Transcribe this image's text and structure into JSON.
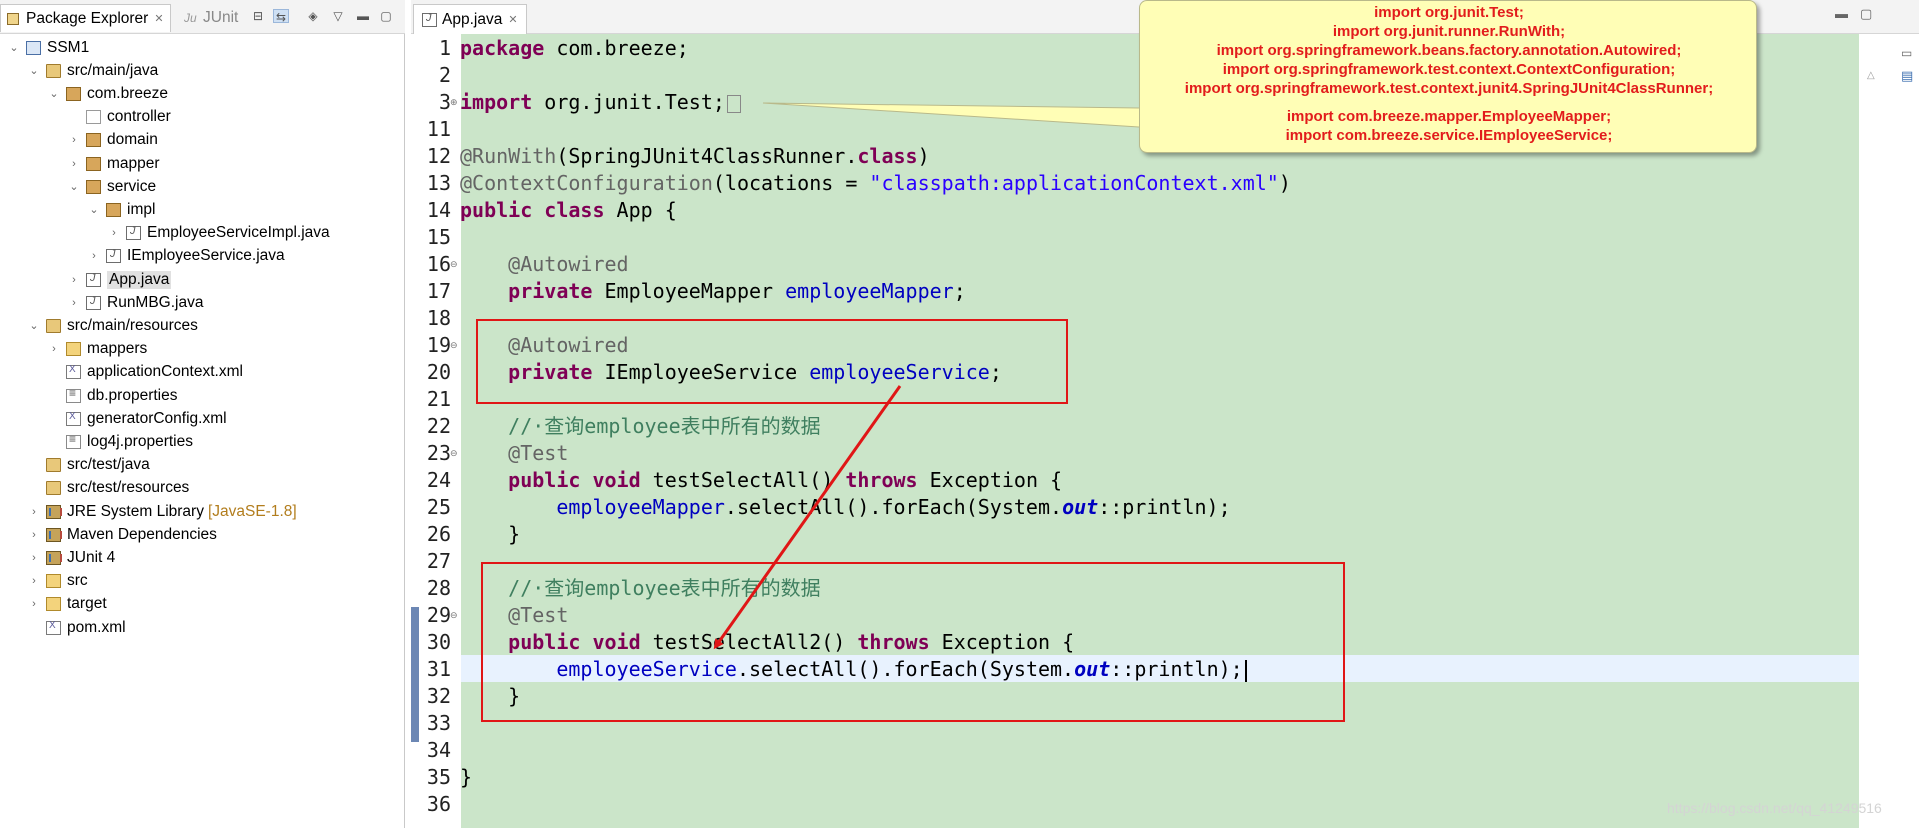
{
  "explorer": {
    "tab_label": "Package Explorer",
    "junit_tab_label": "JUnit",
    "tree": [
      {
        "label": "SSM1",
        "arrow": "v",
        "icon": "project"
      },
      {
        "label": "src/main/java",
        "arrow": "v",
        "icon": "srcfolder"
      },
      {
        "label": "com.breeze",
        "arrow": "v",
        "icon": "package"
      },
      {
        "label": "controller",
        "arrow": "",
        "icon": "package-empty"
      },
      {
        "label": "domain",
        "arrow": ">",
        "icon": "package"
      },
      {
        "label": "mapper",
        "arrow": ">",
        "icon": "package"
      },
      {
        "label": "service",
        "arrow": "v",
        "icon": "package"
      },
      {
        "label": "impl",
        "arrow": "v",
        "icon": "package"
      },
      {
        "label": "EmployeeServiceImpl.java",
        "arrow": ">",
        "icon": "java"
      },
      {
        "label": "IEmployeeService.java",
        "arrow": ">",
        "icon": "java"
      },
      {
        "label": "App.java",
        "arrow": ">",
        "icon": "java",
        "selected": true
      },
      {
        "label": "RunMBG.java",
        "arrow": ">",
        "icon": "java"
      },
      {
        "label": "src/main/resources",
        "arrow": "v",
        "icon": "srcfolder"
      },
      {
        "label": "mappers",
        "arrow": ">",
        "icon": "folder"
      },
      {
        "label": "applicationContext.xml",
        "arrow": "",
        "icon": "xml"
      },
      {
        "label": "db.properties",
        "arrow": "",
        "icon": "props"
      },
      {
        "label": "generatorConfig.xml",
        "arrow": "",
        "icon": "xml"
      },
      {
        "label": "log4j.properties",
        "arrow": "",
        "icon": "props"
      },
      {
        "label": "src/test/java",
        "arrow": "",
        "icon": "srcfolder"
      },
      {
        "label": "src/test/resources",
        "arrow": "",
        "icon": "srcfolder"
      },
      {
        "label": "JRE System Library",
        "decoration": "[JavaSE-1.8]",
        "arrow": ">",
        "icon": "lib"
      },
      {
        "label": "Maven Dependencies",
        "arrow": ">",
        "icon": "lib"
      },
      {
        "label": "JUnit 4",
        "arrow": ">",
        "icon": "lib"
      },
      {
        "label": "src",
        "arrow": ">",
        "icon": "folder"
      },
      {
        "label": "target",
        "arrow": ">",
        "icon": "folder"
      },
      {
        "label": "pom.xml",
        "arrow": "",
        "icon": "xml"
      }
    ]
  },
  "editor": {
    "tab_label": "App.java",
    "line_numbers": [
      "1",
      "2",
      "3",
      "11",
      "12",
      "13",
      "14",
      "15",
      "16",
      "17",
      "18",
      "19",
      "20",
      "21",
      "22",
      "23",
      "24",
      "25",
      "26",
      "27",
      "28",
      "29",
      "30",
      "31",
      "32",
      "33",
      "34",
      "35",
      "36"
    ],
    "lines": [
      [
        [
          "kw",
          "package"
        ],
        [
          "",
          " com.breeze;"
        ]
      ],
      [],
      [
        [
          "kw",
          "import"
        ],
        [
          "",
          " org.junit.Test;"
        ]
      ],
      [],
      [
        [
          "ann",
          "@RunWith"
        ],
        [
          "",
          "(SpringJUnit4ClassRunner."
        ],
        [
          "kw",
          "class"
        ],
        [
          "",
          ")"
        ]
      ],
      [
        [
          "ann",
          "@ContextConfiguration"
        ],
        [
          "",
          "(locations = "
        ],
        [
          "str",
          "\"classpath:applicationContext.xml\""
        ],
        [
          "",
          ")"
        ]
      ],
      [
        [
          "kw",
          "public"
        ],
        [
          "",
          " "
        ],
        [
          "kw",
          "class"
        ],
        [
          "",
          " App {"
        ]
      ],
      [],
      [
        [
          "",
          "    "
        ],
        [
          "ann",
          "@Autowired"
        ]
      ],
      [
        [
          "",
          "    "
        ],
        [
          "kw",
          "private"
        ],
        [
          "",
          " EmployeeMapper "
        ],
        [
          "fld",
          "employeeMapper"
        ],
        [
          "",
          ";"
        ]
      ],
      [],
      [
        [
          "",
          "    "
        ],
        [
          "ann",
          "@Autowired"
        ]
      ],
      [
        [
          "",
          "    "
        ],
        [
          "kw",
          "private"
        ],
        [
          "",
          " IEmployeeService "
        ],
        [
          "fld",
          "employeeService"
        ],
        [
          "",
          ";"
        ]
      ],
      [],
      [
        [
          "",
          "    "
        ],
        [
          "cmt",
          "//·查询employee表中所有的数据"
        ]
      ],
      [
        [
          "",
          "    "
        ],
        [
          "ann",
          "@Test"
        ]
      ],
      [
        [
          "",
          "    "
        ],
        [
          "kw",
          "public"
        ],
        [
          "",
          " "
        ],
        [
          "kw",
          "void"
        ],
        [
          "",
          " testSelectAll() "
        ],
        [
          "kw",
          "throws"
        ],
        [
          "",
          " Exception {"
        ]
      ],
      [
        [
          "",
          "        "
        ],
        [
          "fld",
          "employeeMapper"
        ],
        [
          "",
          ".selectAll().forEach(System."
        ],
        [
          "sfld",
          "out"
        ],
        [
          "",
          "::println);"
        ]
      ],
      [
        [
          "",
          "    }"
        ]
      ],
      [],
      [
        [
          "",
          "    "
        ],
        [
          "cmt",
          "//·查询employee表中所有的数据"
        ]
      ],
      [
        [
          "",
          "    "
        ],
        [
          "ann",
          "@Test"
        ]
      ],
      [
        [
          "",
          "    "
        ],
        [
          "kw",
          "public"
        ],
        [
          "",
          " "
        ],
        [
          "kw",
          "void"
        ],
        [
          "",
          " testSelectAll2() "
        ],
        [
          "kw",
          "throws"
        ],
        [
          "",
          " Exception {"
        ]
      ],
      [
        [
          "",
          "        "
        ],
        [
          "fld",
          "employeeService"
        ],
        [
          "",
          ".selectAll().forEach(System."
        ],
        [
          "sfld",
          "out"
        ],
        [
          "",
          "::println);"
        ]
      ],
      [
        [
          "",
          "    }"
        ]
      ],
      [],
      [],
      [
        [
          "",
          "}"
        ]
      ],
      []
    ]
  },
  "callout": {
    "lines": [
      "import org.junit.Test;",
      "import org.junit.runner.RunWith;",
      "import org.springframework.beans.factory.annotation.Autowired;",
      "import org.springframework.test.context.ContextConfiguration;",
      "import org.springframework.test.context.junit4.SpringJUnit4ClassRunner;",
      "import com.breeze.mapper.EmployeeMapper;",
      "import com.breeze.service.IEmployeeService;"
    ]
  },
  "watermark": "https://blog.csdn.net/qq_41249516",
  "colors": {
    "editor_background": "#cbe5c9",
    "current_line": "#e8f2fe",
    "keyword": "#7f0055",
    "annotation": "#646464",
    "string": "#2a00ff",
    "field": "#0000c0",
    "comment": "#3f7f5f",
    "callout_text": "#e21c1c",
    "callout_background": "#fffeb6",
    "highlight_box": "#e01616"
  }
}
